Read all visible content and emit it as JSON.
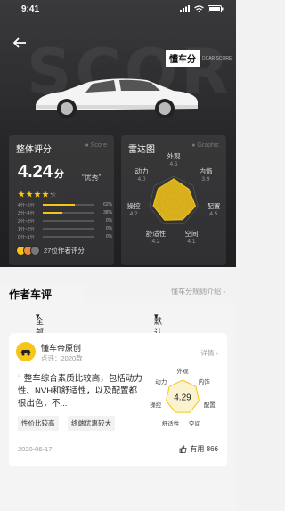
{
  "status_bar": {
    "time": "9:41"
  },
  "hero": {
    "watermark": "SCORE",
    "logo_text": "懂车分",
    "logo_sub": "DCAR SCORE"
  },
  "overall": {
    "title": "整体评分",
    "tag": "Score",
    "score": "4.24",
    "unit": "分",
    "quality": "“优秀”",
    "stars": 4.24,
    "distribution": [
      {
        "label": "4分~5分",
        "value": 62,
        "pct": "62%"
      },
      {
        "label": "3分~4分",
        "value": 38,
        "pct": "38%"
      },
      {
        "label": "2分~3分",
        "value": 0,
        "pct": "0%"
      },
      {
        "label": "1分~2分",
        "value": 0,
        "pct": "0%"
      },
      {
        "label": "0分~1分",
        "value": 0,
        "pct": "0%"
      }
    ],
    "evaluators": "27位作者评分"
  },
  "radar": {
    "title": "雷达图",
    "tag": "Graphic",
    "axes": [
      {
        "name": "外观",
        "value": "4.5"
      },
      {
        "name": "内饰",
        "value": "3.9"
      },
      {
        "name": "配置",
        "value": "4.5"
      },
      {
        "name": "空间",
        "value": "4.1"
      },
      {
        "name": "舒适性",
        "value": "4.2"
      },
      {
        "name": "操控",
        "value": "4.2"
      },
      {
        "name": "动力",
        "value": "4.0"
      }
    ]
  },
  "section": {
    "title": "作者车评",
    "rule_link": "懂车分规则介绍"
  },
  "filters": {
    "year": "全部年款",
    "sort": "默认排序"
  },
  "review": {
    "author": "懂车帝原创",
    "model": "点评：2020款",
    "detail": "详情",
    "text": "整车综合素质比较高，包括动力性、NVH和舒适性，以及配置都很出色，不...",
    "tags": [
      "性价比较高",
      "终端优惠较大"
    ],
    "date": "2020-06-17",
    "likes": "有用 866",
    "mini_score": "4.29",
    "mini_axes": [
      "外观",
      "内饰",
      "配置",
      "空间",
      "舒适性",
      "操控",
      "动力"
    ]
  },
  "colors": {
    "accent": "#f5c518",
    "dark": "#262628"
  }
}
